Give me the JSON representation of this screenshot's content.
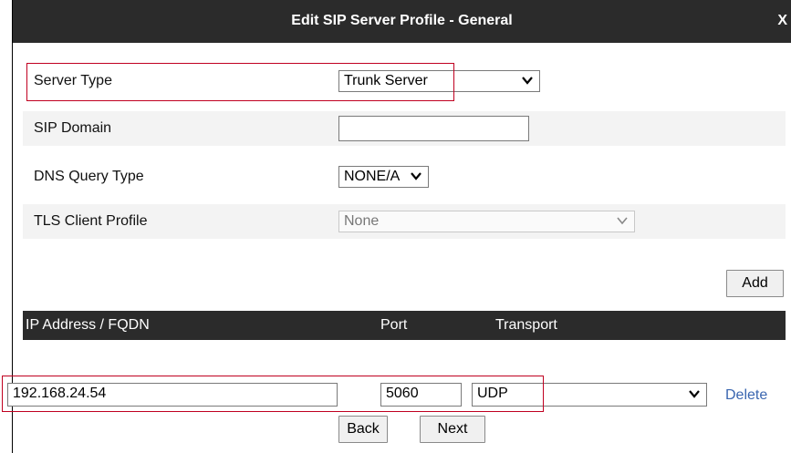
{
  "dialog": {
    "title": "Edit SIP Server Profile - General",
    "close_label": "X"
  },
  "fields": {
    "server_type": {
      "label": "Server Type",
      "value": "Trunk Server"
    },
    "sip_domain": {
      "label": "SIP Domain",
      "value": ""
    },
    "dns_query_type": {
      "label": "DNS Query Type",
      "value": "NONE/A"
    },
    "tls_client_profile": {
      "label": "TLS Client Profile",
      "value": "None"
    }
  },
  "add_label": "Add",
  "table": {
    "headers": {
      "ip": "IP Address / FQDN",
      "port": "Port",
      "transport": "Transport"
    },
    "rows": [
      {
        "ip": "192.168.24.54",
        "port": "5060",
        "transport": "UDP",
        "delete_label": "Delete"
      }
    ]
  },
  "buttons": {
    "back": "Back",
    "next": "Next"
  },
  "colors": {
    "header_bg": "#2b2b2b",
    "highlight": "#c00020",
    "link": "#3a66b0"
  }
}
